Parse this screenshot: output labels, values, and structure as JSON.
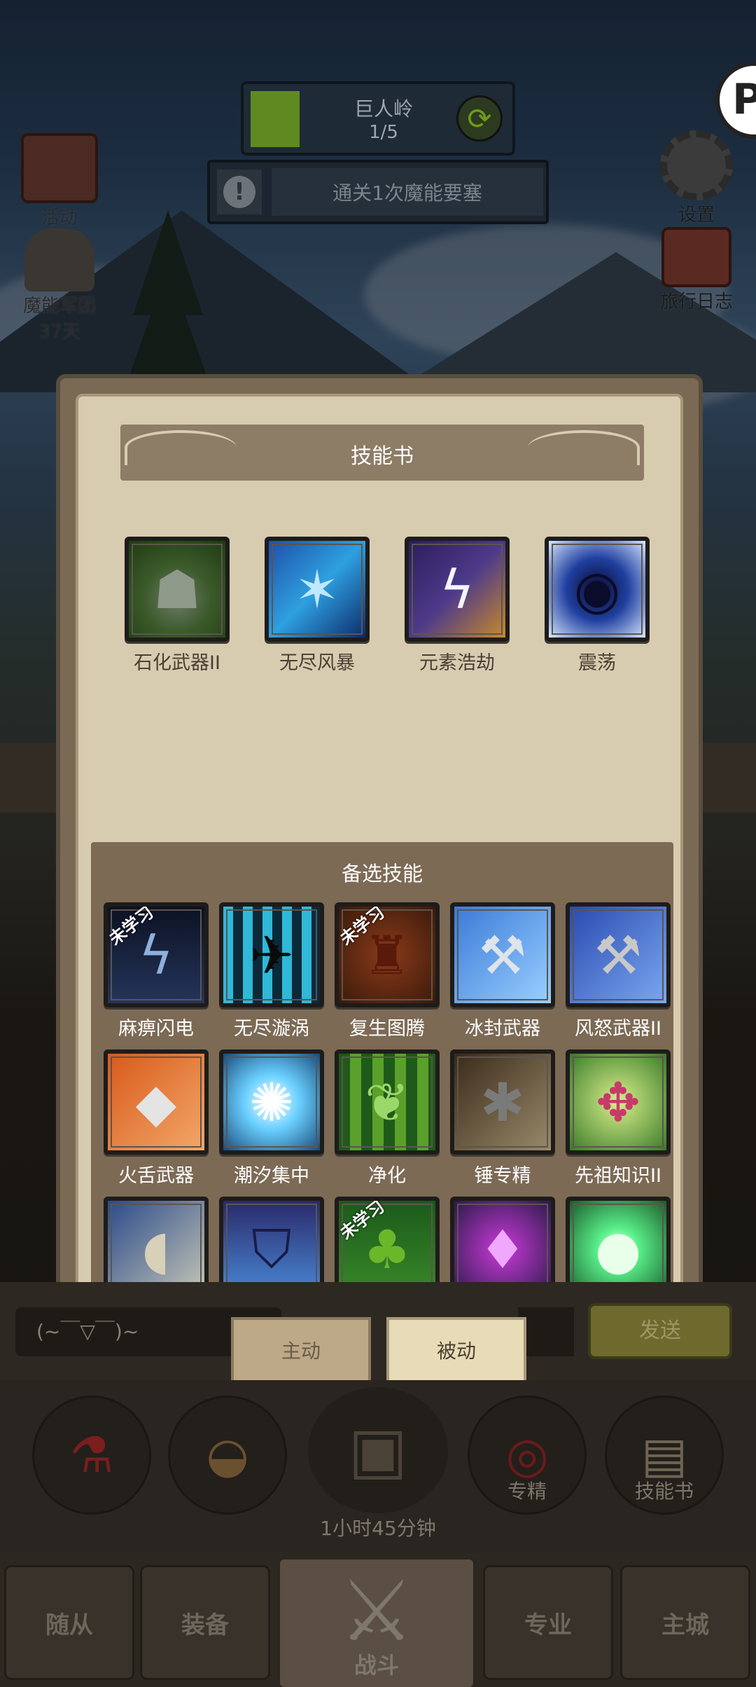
{
  "stage": {
    "name": "巨人岭",
    "progress_text": "1/5"
  },
  "quest": {
    "text": "通关1次魔能要塞"
  },
  "left_menu": [
    {
      "label": "活动",
      "icon": "event-book-icon"
    },
    {
      "label": "魔能军团",
      "sub": "37天",
      "icon": "legion-helmet-icon"
    }
  ],
  "right_menu": [
    {
      "label": "设置",
      "icon": "gear-icon"
    },
    {
      "label": "旅行日志",
      "icon": "travel-log-icon"
    }
  ],
  "skill_book": {
    "title": "技能书",
    "equipped": [
      {
        "name": "石化武器II"
      },
      {
        "name": "无尽风暴"
      },
      {
        "name": "元素浩劫"
      },
      {
        "name": "震荡"
      }
    ],
    "alternate_title": "备选技能",
    "unlearned_tag": "未学习",
    "alternates": [
      {
        "name": "麻痹闪电",
        "unlearned": true
      },
      {
        "name": "无尽漩涡",
        "unlearned": false
      },
      {
        "name": "复生图腾",
        "unlearned": true
      },
      {
        "name": "冰封武器",
        "unlearned": false
      },
      {
        "name": "风怒武器II",
        "unlearned": false
      },
      {
        "name": "火舌武器",
        "unlearned": false
      },
      {
        "name": "潮汐集中",
        "unlearned": false
      },
      {
        "name": "净化",
        "unlearned": false
      },
      {
        "name": "锤专精",
        "unlearned": false
      },
      {
        "name": "先祖知识II",
        "unlearned": false
      },
      {
        "name": "",
        "unlearned": false
      },
      {
        "name": "",
        "unlearned": false
      },
      {
        "name": "",
        "unlearned": true
      },
      {
        "name": "",
        "unlearned": false
      },
      {
        "name": "",
        "unlearned": false
      }
    ]
  },
  "chat": {
    "input_text": "(~￣▽￣)~",
    "send_label": "发送"
  },
  "tabs": {
    "active_label": "主动",
    "passive_label": "被动"
  },
  "actions": {
    "timer": "1小时45分钟",
    "specialize_label": "专精",
    "skillbook_label": "技能书"
  },
  "nav": {
    "followers": "随从",
    "equipment": "装备",
    "battle": "战斗",
    "profession": "专业",
    "main_city": "主城"
  }
}
